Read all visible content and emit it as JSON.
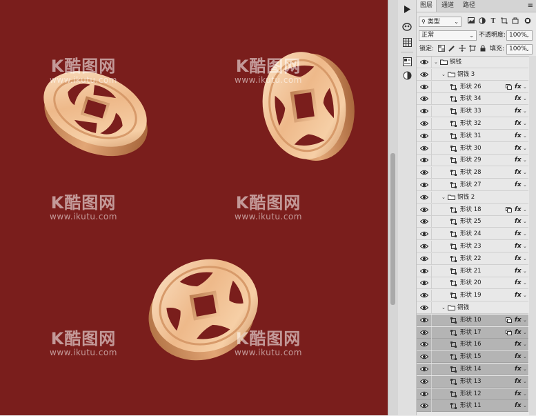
{
  "watermark": {
    "logo": "K酷图网",
    "url": "www.ikutu.com"
  },
  "colors": {
    "canvas_bg": "#7a1e1c",
    "coin_light": "#f8d6b0",
    "coin_dark": "#c5895a"
  },
  "panel": {
    "tabs": [
      "图层",
      "通道",
      "路径"
    ],
    "filter_kind": "类型",
    "blend_mode": "正常",
    "opacity_label": "不透明度:",
    "opacity_value": "100%",
    "lock_label": "锁定:",
    "fill_label": "填充:",
    "fill_value": "100%"
  },
  "layers": [
    {
      "kind": "group",
      "name": "铜钱",
      "depth": 0,
      "selected": false,
      "fx": false
    },
    {
      "kind": "group",
      "name": "铜钱 3",
      "depth": 1,
      "selected": false,
      "fx": false
    },
    {
      "kind": "shape",
      "name": "形状 26",
      "depth": 2,
      "selected": false,
      "fx": true,
      "mask": true
    },
    {
      "kind": "shape",
      "name": "形状 34",
      "depth": 2,
      "selected": false,
      "fx": true
    },
    {
      "kind": "shape",
      "name": "形状 33",
      "depth": 2,
      "selected": false,
      "fx": true
    },
    {
      "kind": "shape",
      "name": "形状 32",
      "depth": 2,
      "selected": false,
      "fx": true
    },
    {
      "kind": "shape",
      "name": "形状 31",
      "depth": 2,
      "selected": false,
      "fx": true
    },
    {
      "kind": "shape",
      "name": "形状 30",
      "depth": 2,
      "selected": false,
      "fx": true
    },
    {
      "kind": "shape",
      "name": "形状 29",
      "depth": 2,
      "selected": false,
      "fx": true
    },
    {
      "kind": "shape",
      "name": "形状 28",
      "depth": 2,
      "selected": false,
      "fx": true
    },
    {
      "kind": "shape",
      "name": "形状 27",
      "depth": 2,
      "selected": false,
      "fx": true
    },
    {
      "kind": "group",
      "name": "铜钱 2",
      "depth": 1,
      "selected": false,
      "fx": false
    },
    {
      "kind": "shape",
      "name": "形状 18",
      "depth": 2,
      "selected": false,
      "fx": true,
      "mask": true
    },
    {
      "kind": "shape",
      "name": "形状 25",
      "depth": 2,
      "selected": false,
      "fx": true
    },
    {
      "kind": "shape",
      "name": "形状 24",
      "depth": 2,
      "selected": false,
      "fx": true
    },
    {
      "kind": "shape",
      "name": "形状 23",
      "depth": 2,
      "selected": false,
      "fx": true
    },
    {
      "kind": "shape",
      "name": "形状 22",
      "depth": 2,
      "selected": false,
      "fx": true
    },
    {
      "kind": "shape",
      "name": "形状 21",
      "depth": 2,
      "selected": false,
      "fx": true
    },
    {
      "kind": "shape",
      "name": "形状 20",
      "depth": 2,
      "selected": false,
      "fx": true
    },
    {
      "kind": "shape",
      "name": "形状 19",
      "depth": 2,
      "selected": false,
      "fx": true
    },
    {
      "kind": "group",
      "name": "铜钱",
      "depth": 1,
      "selected": false,
      "fx": false
    },
    {
      "kind": "shape",
      "name": "形状 10",
      "depth": 2,
      "selected": true,
      "fx": true,
      "mask": true
    },
    {
      "kind": "shape",
      "name": "形状 17",
      "depth": 2,
      "selected": true,
      "fx": true,
      "mask": true
    },
    {
      "kind": "shape",
      "name": "形状 16",
      "depth": 2,
      "selected": true,
      "fx": true
    },
    {
      "kind": "shape",
      "name": "形状 15",
      "depth": 2,
      "selected": true,
      "fx": true
    },
    {
      "kind": "shape",
      "name": "形状 14",
      "depth": 2,
      "selected": true,
      "fx": true
    },
    {
      "kind": "shape",
      "name": "形状 13",
      "depth": 2,
      "selected": true,
      "fx": true
    },
    {
      "kind": "shape",
      "name": "形状 12",
      "depth": 2,
      "selected": true,
      "fx": true
    },
    {
      "kind": "shape",
      "name": "形状 11",
      "depth": 2,
      "selected": true,
      "fx": true
    }
  ]
}
